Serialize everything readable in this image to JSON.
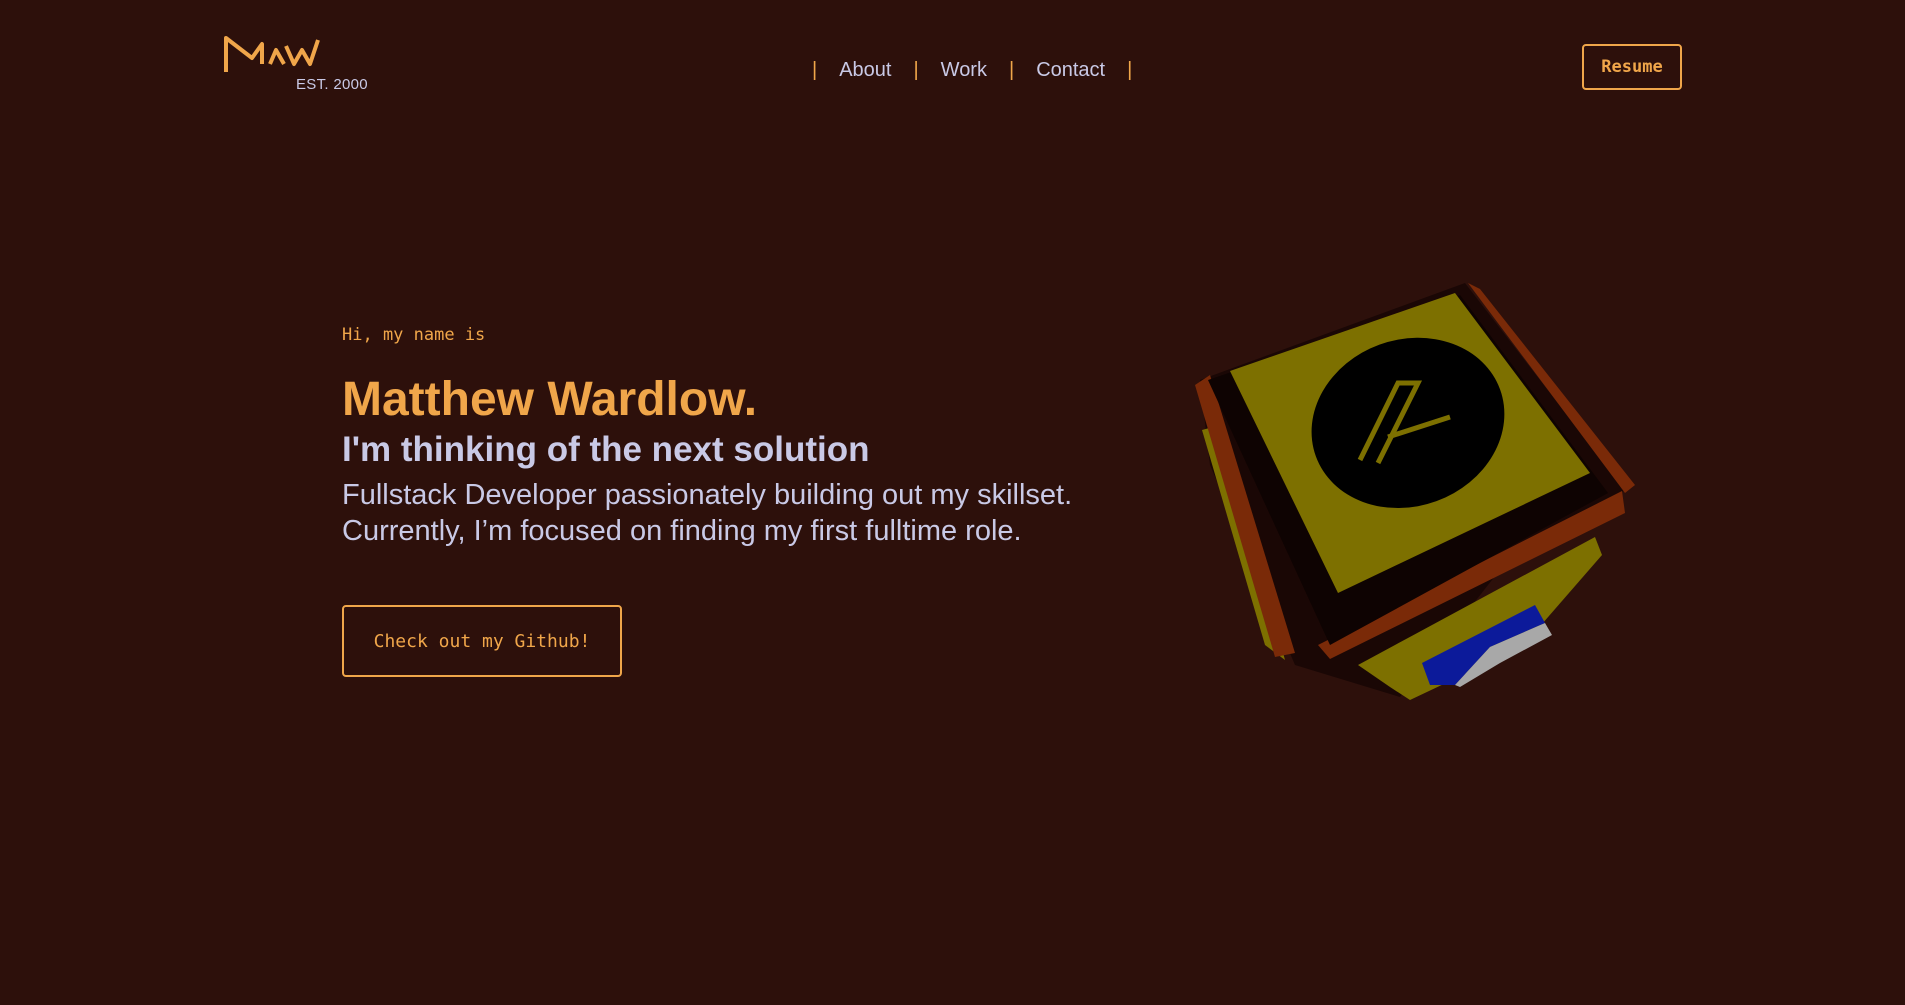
{
  "header": {
    "logo": {
      "text": "MaW",
      "subtitle": "EST. 2000"
    },
    "nav": {
      "items": [
        {
          "label": "About"
        },
        {
          "label": "Work"
        },
        {
          "label": "Contact"
        }
      ],
      "separator": "|"
    },
    "resume_label": "Resume"
  },
  "hero": {
    "intro": "Hi, my name is",
    "name": "Matthew Wardlow.",
    "tagline": "I'm thinking of the next solution",
    "description_line1": "Fullstack Developer passionately building out my skillset.",
    "description_line2": "Currently, I’m focused on finding my first fulltime role.",
    "cta_label": "Check out my Github!"
  },
  "colors": {
    "background": "#2d100b",
    "accent": "#f0a64a",
    "text": "#c9c9e6",
    "cube_face": "#7d7000",
    "cube_edge": "#7a2a08"
  },
  "icons": {
    "cube": "3d-cube-graphic"
  }
}
